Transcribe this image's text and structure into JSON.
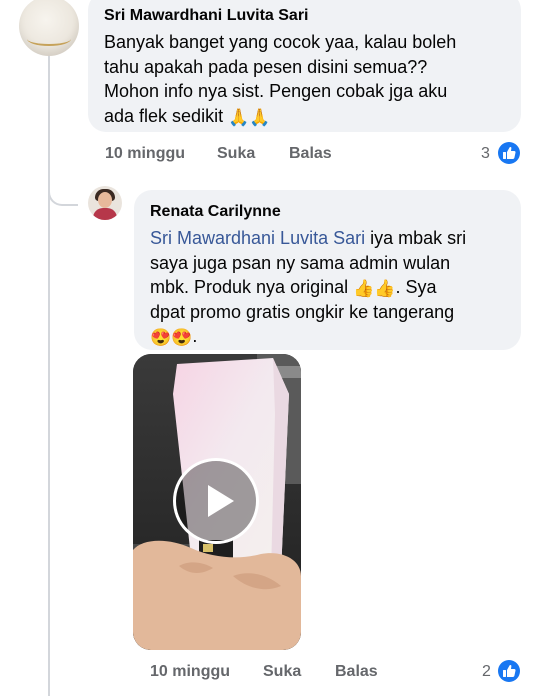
{
  "comment1": {
    "author": "Sri Mawardhani Luvita Sari",
    "lines": [
      "Banyak banget yang cocok yaa, kalau boleh",
      "tahu apakah pada pesen disini semua??",
      "Mohon info nya sist. Pengen cobak jga aku",
      "ada flek sedikit"
    ],
    "emoji": "🙏🙏",
    "time": "10 minggu",
    "like_label": "Suka",
    "reply_label": "Balas",
    "reaction_count": "3"
  },
  "reply1": {
    "author": "Renata Carilynne",
    "mention": "Sri Mawardhani Luvita Sari",
    "line1_rest": " iya mbak sri",
    "line2": "saya juga psan ny sama admin wulan",
    "line3_text": "mbk. Produk nya original ",
    "line3_emoji": "👍👍",
    "line3_rest": ". Sya",
    "line4": "dpat promo gratis ongkir ke tangerang",
    "line5_emoji": "😍😍",
    "line5_rest": ".",
    "time": "10 minggu",
    "like_label": "Suka",
    "reply_label": "Balas",
    "reaction_count": "2"
  },
  "colors": {
    "bubble": "#f0f2f5",
    "like_blue": "#1877f2",
    "mention": "#385898",
    "meta_text": "#65676b"
  }
}
